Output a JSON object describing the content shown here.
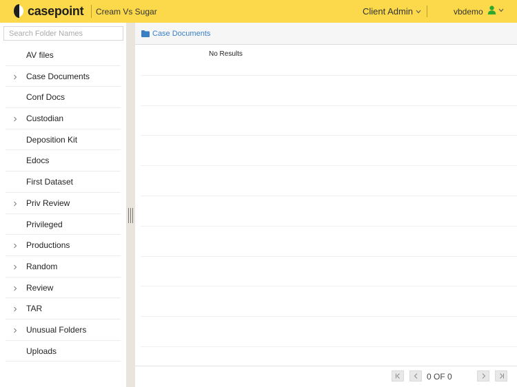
{
  "header": {
    "logo_text": "casepoint",
    "case_name": "Cream Vs Sugar",
    "role_menu": "Client Admin",
    "user_name": "vbdemo",
    "colors": {
      "bar": "#fbd94a",
      "user_icon": "#2ea82e"
    }
  },
  "sidebar": {
    "search_placeholder": "Search Folder Names",
    "folders": [
      {
        "label": "AV files",
        "expandable": false
      },
      {
        "label": "Case Documents",
        "expandable": true
      },
      {
        "label": "Conf Docs",
        "expandable": false
      },
      {
        "label": "Custodian",
        "expandable": true
      },
      {
        "label": "Deposition Kit",
        "expandable": false
      },
      {
        "label": "Edocs",
        "expandable": false
      },
      {
        "label": "First Dataset",
        "expandable": false
      },
      {
        "label": "Priv Review",
        "expandable": true
      },
      {
        "label": "Privileged",
        "expandable": false
      },
      {
        "label": "Productions",
        "expandable": true
      },
      {
        "label": "Random",
        "expandable": true
      },
      {
        "label": "Review",
        "expandable": true
      },
      {
        "label": "TAR",
        "expandable": true
      },
      {
        "label": "Unusual Folders",
        "expandable": true
      },
      {
        "label": "Uploads",
        "expandable": false
      }
    ]
  },
  "main": {
    "breadcrumb": "Case Documents",
    "empty_message": "No Results",
    "pager_text": "0 OF 0",
    "accent": "#3a7fc6"
  }
}
